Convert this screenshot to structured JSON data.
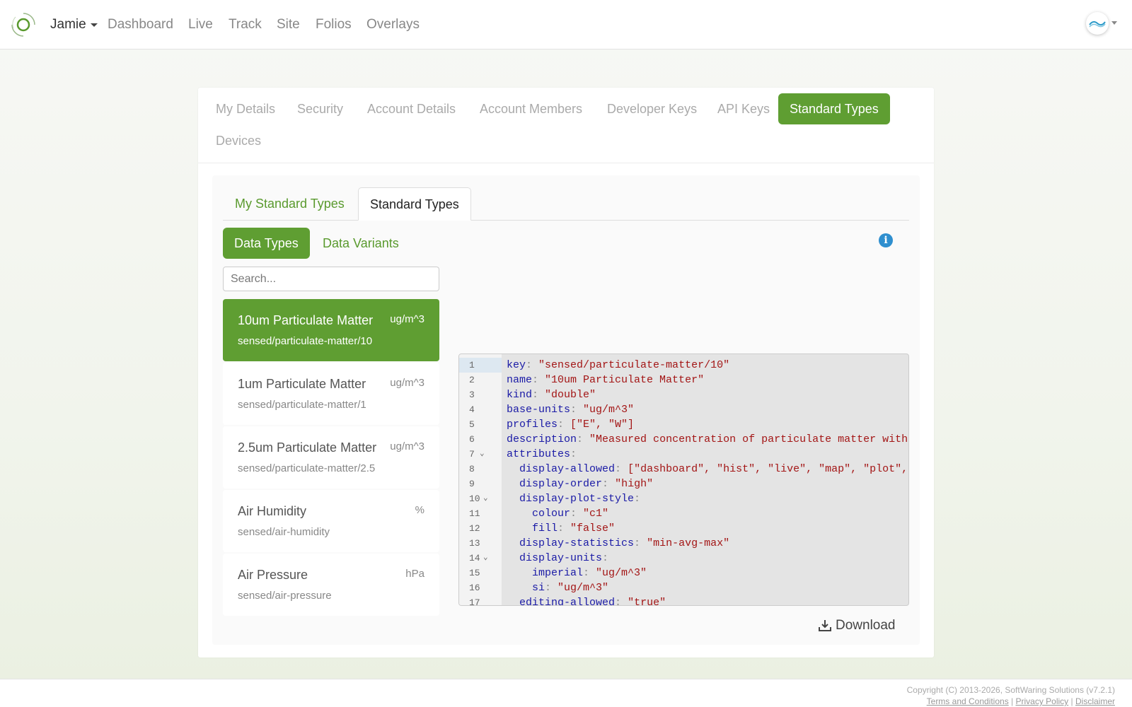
{
  "nav": {
    "user": "Jamie",
    "links": [
      "Dashboard",
      "Live",
      "Track",
      "Site",
      "Folios",
      "Overlays"
    ]
  },
  "settings_tabs": [
    "My Details",
    "Security",
    "Account Details",
    "Account Members",
    "Developer Keys",
    "API Keys",
    "Standard Types",
    "Devices"
  ],
  "settings_active": "Standard Types",
  "sub_tabs": [
    "My Standard Types",
    "Standard Types"
  ],
  "sub_tab_active": "Standard Types",
  "type_tabs": [
    "Data Types",
    "Data Variants"
  ],
  "type_tab_active": "Data Types",
  "search": {
    "placeholder": "Search...",
    "value": ""
  },
  "data_types": [
    {
      "name": "10um Particulate Matter",
      "unit": "ug/m^3",
      "key": "sensed/particulate-matter/10",
      "selected": true
    },
    {
      "name": "1um Particulate Matter",
      "unit": "ug/m^3",
      "key": "sensed/particulate-matter/1"
    },
    {
      "name": "2.5um Particulate Matter",
      "unit": "ug/m^3",
      "key": "sensed/particulate-matter/2.5"
    },
    {
      "name": "Air Humidity",
      "unit": "%",
      "key": "sensed/air-humidity"
    },
    {
      "name": "Air Pressure",
      "unit": "hPa",
      "key": "sensed/air-pressure"
    }
  ],
  "editor": {
    "lines": [
      {
        "n": "1",
        "fold": "",
        "indent": "",
        "key": "key",
        "value": "\"sensed/particulate-matter/10\""
      },
      {
        "n": "2",
        "fold": "",
        "indent": "",
        "key": "name",
        "value": "\"10um Particulate Matter\""
      },
      {
        "n": "3",
        "fold": "",
        "indent": "",
        "key": "kind",
        "value": "\"double\""
      },
      {
        "n": "4",
        "fold": "",
        "indent": "",
        "key": "base-units",
        "value": "\"ug/m^3\""
      },
      {
        "n": "5",
        "fold": "",
        "indent": "",
        "key": "profiles",
        "value": "[\"E\", \"W\"]"
      },
      {
        "n": "6",
        "fold": "",
        "indent": "",
        "key": "description",
        "value": "\"Measured concentration of particulate matter with"
      },
      {
        "n": "7",
        "fold": "⌄",
        "indent": "",
        "key": "attributes",
        "value": ""
      },
      {
        "n": "8",
        "fold": "",
        "indent": "  ",
        "key": "display-allowed",
        "value": "[\"dashboard\", \"hist\", \"live\", \"map\", \"plot\","
      },
      {
        "n": "9",
        "fold": "",
        "indent": "  ",
        "key": "display-order",
        "value": "\"high\""
      },
      {
        "n": "10",
        "fold": "⌄",
        "indent": "  ",
        "key": "display-plot-style",
        "value": ""
      },
      {
        "n": "11",
        "fold": "",
        "indent": "    ",
        "key": "colour",
        "value": "\"c1\""
      },
      {
        "n": "12",
        "fold": "",
        "indent": "    ",
        "key": "fill",
        "value": "\"false\""
      },
      {
        "n": "13",
        "fold": "",
        "indent": "  ",
        "key": "display-statistics",
        "value": "\"min-avg-max\""
      },
      {
        "n": "14",
        "fold": "⌄",
        "indent": "  ",
        "key": "display-units",
        "value": ""
      },
      {
        "n": "15",
        "fold": "",
        "indent": "    ",
        "key": "imperial",
        "value": "\"ug/m^3\""
      },
      {
        "n": "16",
        "fold": "",
        "indent": "    ",
        "key": "si",
        "value": "\"ug/m^3\""
      },
      {
        "n": "17",
        "fold": "",
        "indent": "  ",
        "key": "editing-allowed",
        "value": "\"true\""
      }
    ]
  },
  "download_label": "Download",
  "footer": {
    "copyright": "Copyright (C) 2013-2026, SoftWaring Solutions (v7.2.1)",
    "links": [
      "Terms and Conditions",
      "Privacy Policy",
      "Disclaimer"
    ]
  },
  "colors": {
    "accent": "#5f9e32",
    "link_green": "#5a9a2e",
    "info_blue": "#2f8fcf"
  },
  "icons": {
    "logo": "ring-logo-icon",
    "avatar": "wave-avatar-icon",
    "info": "info-icon",
    "download": "download-icon"
  }
}
